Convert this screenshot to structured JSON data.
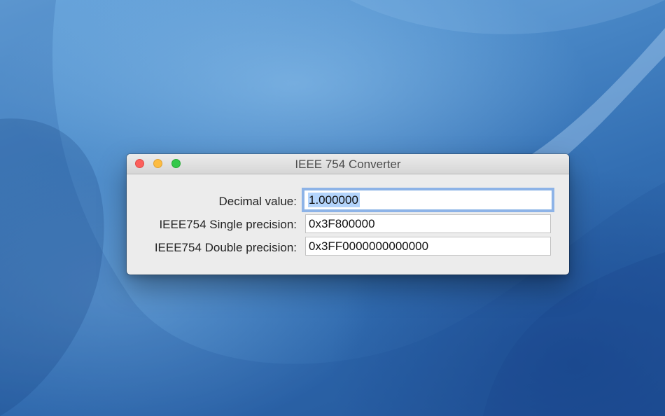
{
  "window": {
    "title": "IEEE 754 Converter",
    "controls": {
      "close_color": "#fc605c",
      "minimize_color": "#fdbc40",
      "zoom_color": "#34c84a"
    }
  },
  "form": {
    "decimal": {
      "label": "Decimal value:",
      "value": "1.000000",
      "focused": true,
      "selected": true
    },
    "single": {
      "label": "IEEE754 Single precision:",
      "value": "0x3F800000"
    },
    "double": {
      "label": "IEEE754 Double precision:",
      "value": "0x3FF0000000000000"
    }
  },
  "colors": {
    "desktop_blue": "#3a78bd",
    "focus_ring": "#6ea0e6",
    "selection": "#b3d4fc"
  }
}
